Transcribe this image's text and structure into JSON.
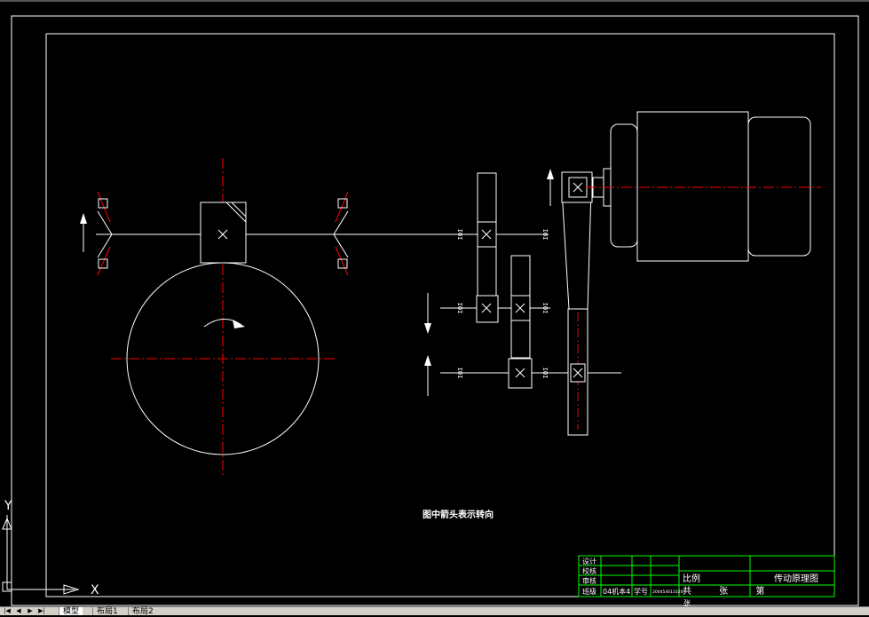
{
  "drawing": {
    "note": "图中箭头表示转向",
    "bearing_mark": "IOI",
    "title_block": {
      "roles": [
        "设计",
        "校核",
        "审核",
        "班级"
      ],
      "class_value": "04机本4",
      "student_no_label": "学号",
      "student_no_value": "2004540110207",
      "scale_label": "比例",
      "sheet_line": "共 张 第",
      "sheet_line2": "张",
      "drawing_title": "传动原理图"
    },
    "ucs": {
      "y_label": "Y",
      "x_label": "X"
    }
  },
  "layout_tabs": {
    "nav": [
      "|◀",
      "◀",
      "▶",
      "▶|"
    ],
    "tabs": [
      "模型",
      "布局1",
      "布局2"
    ],
    "active": "模型"
  },
  "colors": {
    "background": "#000000",
    "line": "#ffffff",
    "centerline": "#ff0000",
    "title_block_border": "#00ff00"
  }
}
